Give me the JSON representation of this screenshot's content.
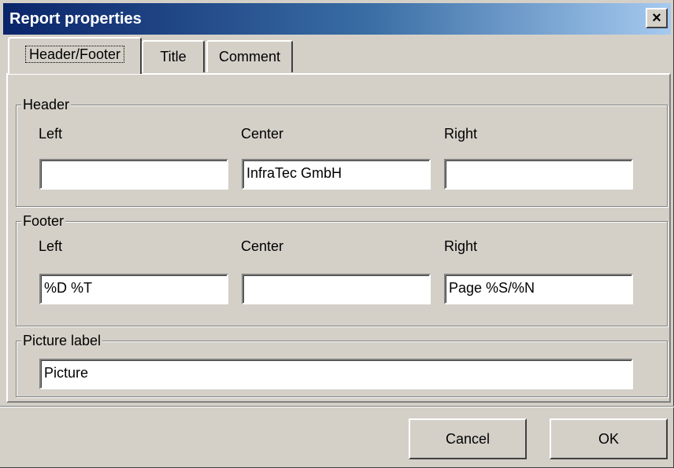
{
  "window": {
    "title": "Report properties",
    "close_glyph": "×"
  },
  "tabs": [
    {
      "label": "Header/Footer",
      "active": true
    },
    {
      "label": "Title",
      "active": false
    },
    {
      "label": "Comment",
      "active": false
    }
  ],
  "header": {
    "legend": "Header",
    "left_label": "Left",
    "center_label": "Center",
    "right_label": "Right",
    "left_value": "",
    "center_value": "InfraTec GmbH",
    "right_value": ""
  },
  "footer": {
    "legend": "Footer",
    "left_label": "Left",
    "center_label": "Center",
    "right_label": "Right",
    "left_value": "%D %T",
    "center_value": "",
    "right_value": "Page %S/%N"
  },
  "picture": {
    "legend": "Picture label",
    "value": "Picture"
  },
  "buttons": {
    "cancel": "Cancel",
    "ok": "OK"
  },
  "colors": {
    "title_start": "#0a246a",
    "title_end": "#a6caf0",
    "face": "#d4d0c8"
  }
}
